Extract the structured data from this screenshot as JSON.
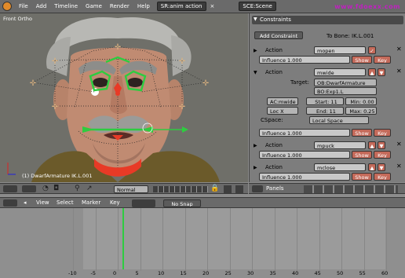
{
  "menubar": {
    "items": [
      "File",
      "Add",
      "Timeline",
      "Game",
      "Render",
      "Help"
    ],
    "screen_label": "SR:anim action",
    "scene_label": "SCE:Scene",
    "watermark": "www.fdoexx.com"
  },
  "viewport": {
    "mode_label": "Front Ortho",
    "object_label": "(1) DwarfArmature IK.L.001"
  },
  "constraints": {
    "title": "Constraints",
    "add_button": "Add Constraint",
    "to_bone": "To Bone: IK.L.001",
    "items": [
      {
        "type": "Action",
        "name": "mopen",
        "influence": "Influence 1.000",
        "show": "Show",
        "key": "Key"
      },
      {
        "type": "Action",
        "name": "mwide",
        "influence": "Influence 1.000",
        "show": "Show",
        "key": "Key",
        "expanded": true,
        "target_label": "Target:",
        "target_ob": "OB:DwarfArmature",
        "target_bone": "BO:Exp1.L",
        "ac": "AC:mwide",
        "start": "Start: 11",
        "min": "Min: 0.00",
        "loc": "Loc X",
        "end": "End: 11",
        "max": "Max: 0.25",
        "cspace_label": "CSpace:",
        "cspace_value": "Local Space"
      },
      {
        "type": "Action",
        "name": "mpuck",
        "influence": "Influence 1.000",
        "show": "Show",
        "key": "Key"
      },
      {
        "type": "Action",
        "name": "mclose",
        "influence": "Influence 1.000",
        "show": "Show",
        "key": "Key"
      }
    ]
  },
  "view_header": {
    "mode": "Normal"
  },
  "buttons_header": {
    "panels_label": "Panels"
  },
  "timeline_header": {
    "menus": [
      "View",
      "Select",
      "Marker",
      "Key"
    ],
    "snap": "No Snap"
  },
  "timeline": {
    "ticks": [
      "-10",
      "-5",
      "0",
      "5",
      "10",
      "15",
      "20",
      "25",
      "30",
      "35",
      "40",
      "45",
      "50",
      "55",
      "60"
    ],
    "current_frame": 1
  }
}
